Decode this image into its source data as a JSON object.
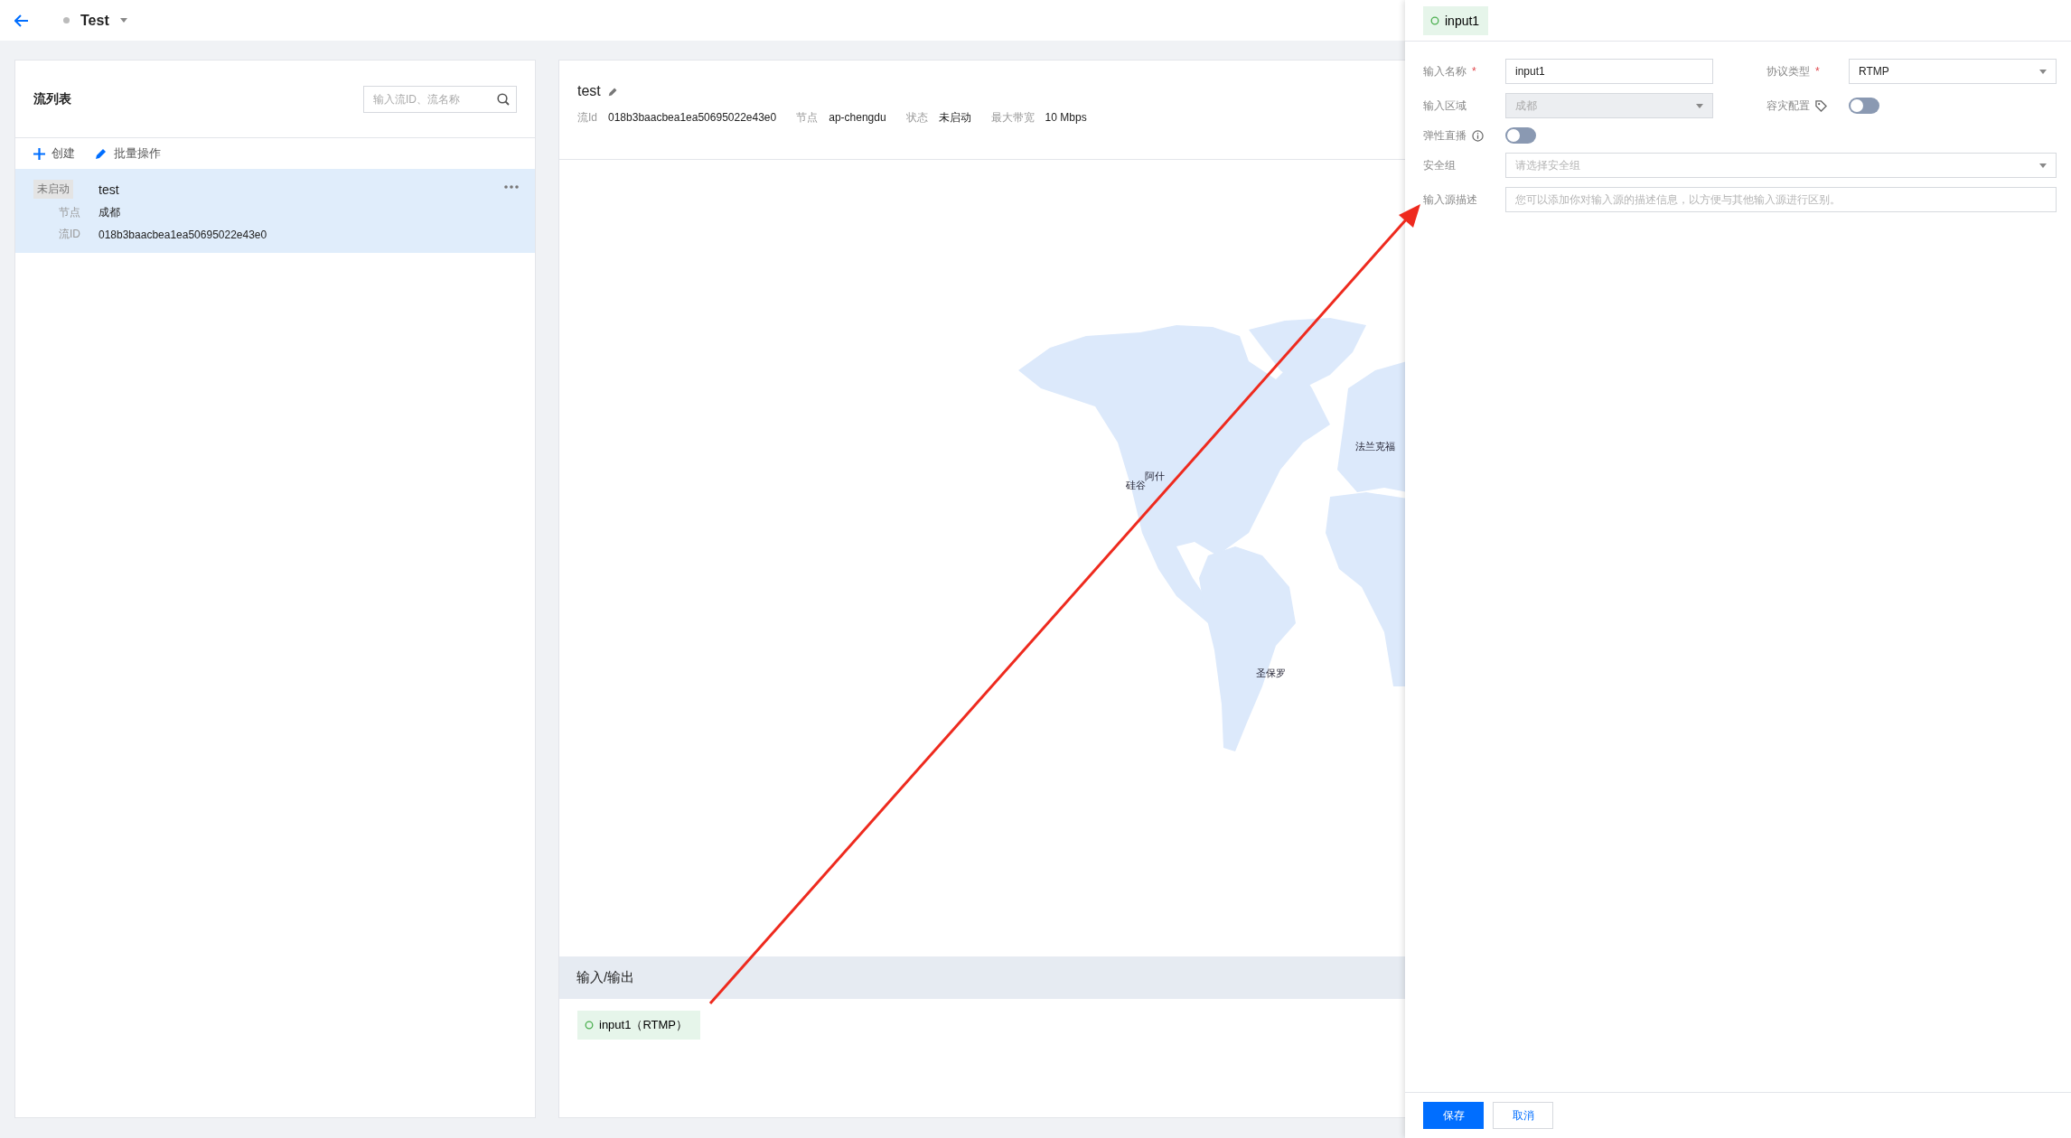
{
  "header": {
    "title": "Test"
  },
  "stream_list": {
    "title": "流列表",
    "search": {
      "placeholder": "输入流ID、流名称"
    },
    "actions": [
      {
        "label": "创建",
        "kind": "create"
      },
      {
        "label": "批量操作",
        "kind": "edit"
      }
    ],
    "items": [
      {
        "status": "未启动",
        "name": "test",
        "selected": true,
        "fields": [
          {
            "label": "节点",
            "value": "成都"
          },
          {
            "label": "流ID",
            "value": "018b3baacbea1ea50695022e43e0"
          }
        ]
      }
    ]
  },
  "detail": {
    "title": "test",
    "meta": [
      {
        "label": "流Id",
        "value": "018b3baacbea1ea50695022e43e0"
      },
      {
        "label": "节点",
        "value": "ap-chengdu"
      },
      {
        "label": "状态",
        "value": "未启动"
      },
      {
        "label": "最大带宽",
        "value": "10 Mbps"
      }
    ],
    "map": {
      "labels": [
        "硅谷",
        "阿什",
        "法兰克福",
        "圣保罗"
      ]
    },
    "io": {
      "title": "输入/输出",
      "inputs": [
        {
          "label": "input1（RTMP）"
        }
      ]
    }
  },
  "drawer": {
    "tab": "input1",
    "rows": [
      [
        {
          "label": "输入名称",
          "required_mark": "*",
          "kind": "text",
          "value": "input1",
          "disabled": false
        },
        {
          "label": "协议类型",
          "required_mark": "*",
          "kind": "select",
          "value": "RTMP",
          "disabled": false
        }
      ],
      [
        {
          "label": "输入区域",
          "kind": "select",
          "value": "成都",
          "disabled": true
        },
        {
          "label": "容灾配置",
          "kind": "toggle",
          "on": false
        }
      ],
      [
        {
          "label": "弹性直播",
          "kind": "toggle",
          "on": false
        }
      ],
      [
        {
          "label": "安全组",
          "kind": "select",
          "placeholder": "请选择安全组",
          "disabled": false
        }
      ],
      [
        {
          "label": "输入源描述",
          "kind": "text",
          "placeholder": "您可以添加你对输入源的描述信息，以方便与其他输入源进行区别。",
          "disabled": false
        }
      ]
    ],
    "buttons": [
      {
        "label": "保存",
        "kind": "primary"
      },
      {
        "label": "取消",
        "kind": "default"
      }
    ]
  }
}
